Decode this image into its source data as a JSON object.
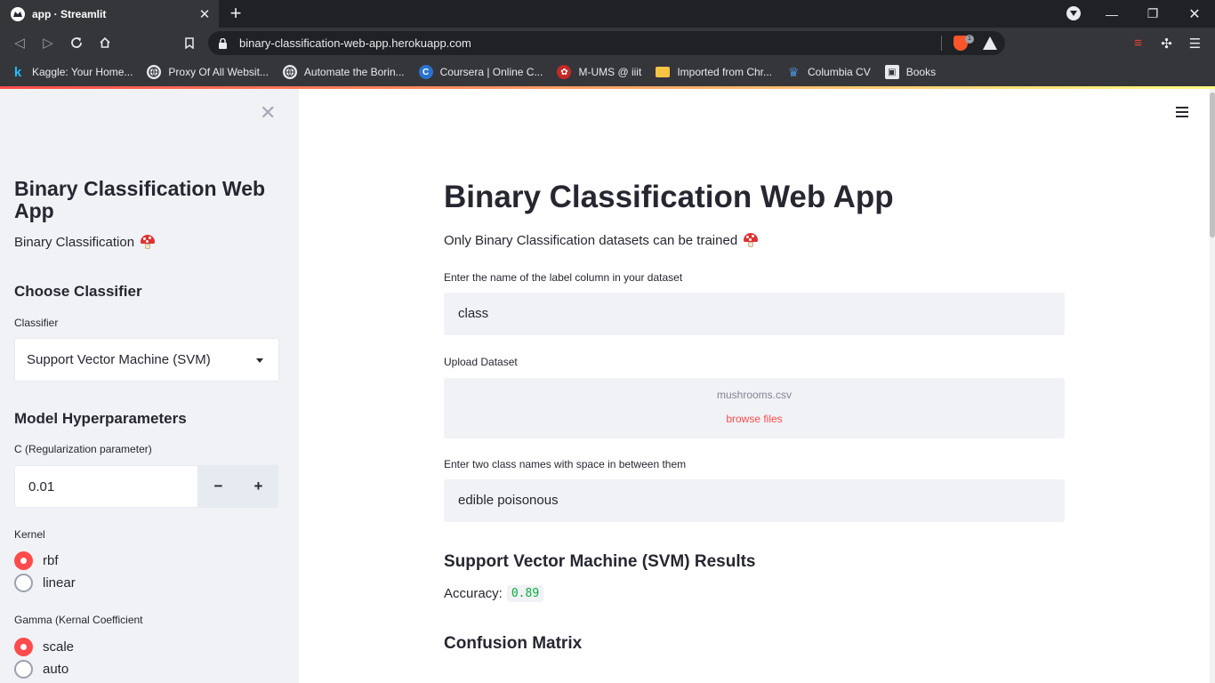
{
  "browser": {
    "tab_title": "app · Streamlit",
    "url": "binary-classification-web-app.herokuapp.com",
    "ext_badge": "1",
    "bookmarks": [
      {
        "label": "Kaggle: Your Home...",
        "icon": "kaggle-icon",
        "color": "#20beff",
        "glyph": "k"
      },
      {
        "label": "Proxy Of All Websit...",
        "icon": "globe-icon",
        "color": "#9aa0a6",
        "glyph": "◍"
      },
      {
        "label": "Automate the Borin...",
        "icon": "globe-icon",
        "color": "#9aa0a6",
        "glyph": "◍"
      },
      {
        "label": "Coursera | Online C...",
        "icon": "coursera-icon",
        "color": "#2a73cc",
        "glyph": "C"
      },
      {
        "label": "M-UMS @ iiit",
        "icon": "mums-icon",
        "color": "#c62828",
        "glyph": "✿"
      },
      {
        "label": "Imported from Chr...",
        "icon": "folder-icon",
        "color": "#f6c343",
        "glyph": ""
      },
      {
        "label": "Columbia CV",
        "icon": "columbia-crown-icon",
        "color": "#1d4f91",
        "glyph": "♛"
      },
      {
        "label": "Books",
        "icon": "books-icon",
        "color": "#5f6368",
        "glyph": "▣"
      }
    ]
  },
  "sidebar": {
    "title": "Binary Classification Web App",
    "subtitle": "Binary Classification",
    "choose_heading": "Choose Classifier",
    "classifier_label": "Classifier",
    "classifier_value": "Support Vector Machine (SVM)",
    "hyper_heading": "Model Hyperparameters",
    "c_label": "C (Regularization parameter)",
    "c_value": "0.01",
    "minus": "−",
    "plus": "+",
    "kernel_label": "Kernel",
    "kernel_options": [
      "rbf",
      "linear"
    ],
    "kernel_selected": "rbf",
    "gamma_label": "Gamma (Kernal Coefficient",
    "gamma_options": [
      "scale",
      "auto"
    ],
    "gamma_selected": "scale"
  },
  "main": {
    "title": "Binary Classification Web App",
    "subtitle": "Only Binary Classification datasets can be trained",
    "label_col_label": "Enter the name of the label column in your dataset",
    "label_col_value": "class",
    "upload_label": "Upload Dataset",
    "upload_filename": "mushrooms.csv",
    "browse_text": "browse files",
    "class_names_label": "Enter two class names with space in between them",
    "class_names_value": "edible poisonous",
    "results_heading": "Support Vector Machine (SVM) Results",
    "accuracy_label": "Accuracy:",
    "accuracy_value": "0.89",
    "confusion_heading": "Confusion Matrix"
  },
  "colors": {
    "accent": "#ff4b4b",
    "sidebar_bg": "#f0f2f6",
    "accuracy_code": "#09ab3b"
  }
}
